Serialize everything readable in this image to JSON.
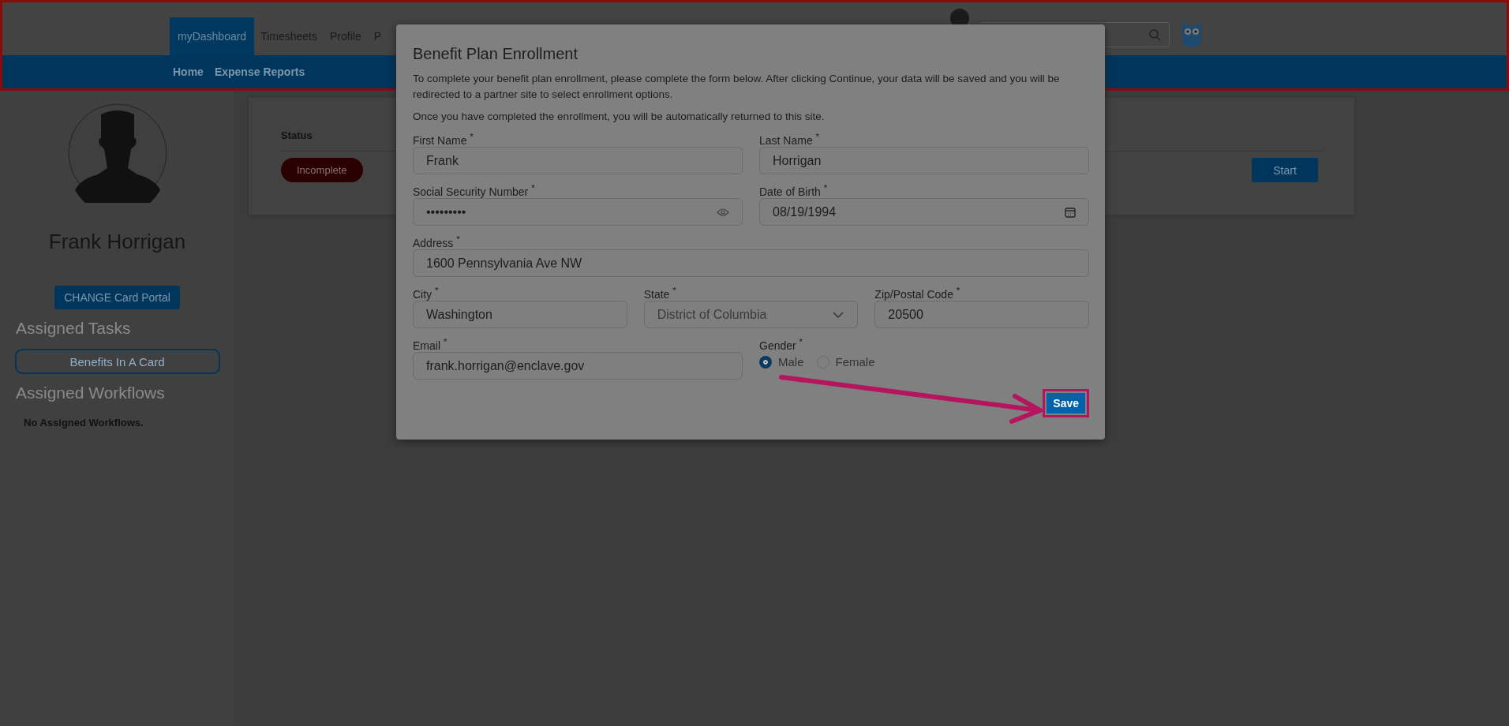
{
  "header": {
    "tabs": [
      {
        "label": "myDashboard",
        "selected": true
      },
      {
        "label": "Timesheets",
        "selected": false
      },
      {
        "label": "Profile",
        "selected": false
      },
      {
        "label": "P",
        "selected": false
      }
    ],
    "subnav": [
      "Home",
      "Expense Reports"
    ]
  },
  "sidebar": {
    "name": "Frank Horrigan",
    "portal_button": "CHANGE Card Portal",
    "tasks_heading": "Assigned Tasks",
    "tasks": [
      "Benefits In A Card"
    ],
    "workflows_heading": "Assigned Workflows",
    "workflows_empty": "No Assigned Workflows."
  },
  "task_card": {
    "column": "Status",
    "status": "Incomplete",
    "action": "Start"
  },
  "modal": {
    "title": "Benefit Plan Enrollment",
    "paragraphs": [
      "To complete your benefit plan enrollment, please complete the form below. After clicking Continue, your data will be saved and you will be redirected to a partner site to select enrollment options.",
      "Once you have completed the enrollment, you will be automatically returned to this site."
    ],
    "rows": [
      [
        {
          "kind": "text",
          "label": "First Name $^{*}$",
          "value": "Frank"
        },
        {
          "kind": "text",
          "label": "Last Name $^{*}$",
          "value": "Horrigan"
        }
      ],
      [
        {
          "kind": "password",
          "label": "Social Security Number $^{*}$",
          "value": "•••••••••"
        },
        {
          "kind": "date",
          "label": "Date of Birth $^{*}$",
          "value": "08/19/1994"
        }
      ],
      [
        {
          "kind": "text",
          "label": "Address $^{*}$",
          "value": "1600 Pennsylvania Ave NW"
        }
      ],
      [
        {
          "kind": "text",
          "label": "City $^{*}$",
          "value": "Washington"
        },
        {
          "kind": "select",
          "label": "State $^{*}$",
          "value": "District of Columbia"
        },
        {
          "kind": "text",
          "label": "Zip/Postal Code $^{*}$",
          "value": "20500"
        }
      ],
      [
        {
          "kind": "text",
          "label": "Email $^{*}$",
          "value": "frank.horrigan@enclave.gov"
        },
        {
          "kind": "radio",
          "label": "Gender $^{*}$",
          "options": [
            {
              "label": "Male",
              "selected": true
            },
            {
              "label": "Female",
              "selected": false
            }
          ]
        }
      ]
    ],
    "save": "Save"
  }
}
